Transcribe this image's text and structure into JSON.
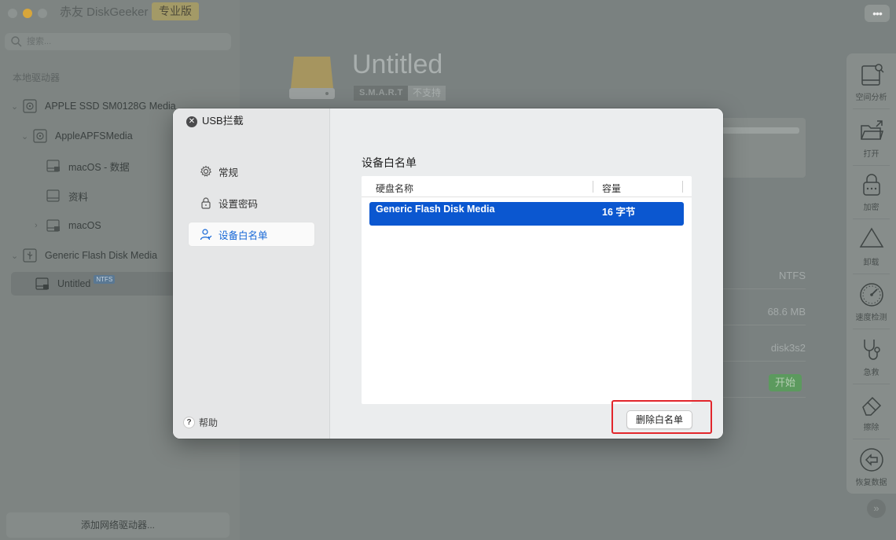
{
  "window": {
    "app_title": "赤友 DiskGeeker",
    "edition_badge": "专业版",
    "more_label": "•••"
  },
  "sidebar": {
    "search_placeholder": "搜索...",
    "section_label": "本地驱动器",
    "tree": [
      {
        "label": "APPLE SSD SM0128G Media",
        "level": 0,
        "expanded": true
      },
      {
        "label": "AppleAPFSMedia",
        "level": 1,
        "expanded": true
      },
      {
        "label": "macOS - 数据",
        "level": 2
      },
      {
        "label": "资料",
        "level": 2
      },
      {
        "label": "macOS",
        "level": 2,
        "collapsed": true
      },
      {
        "label": "Generic Flash Disk Media",
        "level": 0,
        "expanded": true
      },
      {
        "label": "Untitled",
        "level": 1,
        "badge": "NTFS",
        "selected": true
      }
    ],
    "add_network_label": "添加网络驱动器..."
  },
  "main": {
    "disk_title": "Untitled",
    "smart_label": "S.M.A.R.T",
    "smart_status": "不支持",
    "info_values": [
      "NTFS",
      "68.6 MB",
      "disk3s2"
    ],
    "start_label": "开始"
  },
  "toolbar": {
    "items": [
      {
        "label": "空间分析",
        "icon": "space-analysis-icon"
      },
      {
        "label": "打开",
        "icon": "folder-open-icon"
      },
      {
        "label": "加密",
        "icon": "lock-icon"
      },
      {
        "label": "卸载",
        "icon": "eject-icon"
      },
      {
        "label": "速度检测",
        "icon": "speedometer-icon"
      },
      {
        "label": "急救",
        "icon": "stethoscope-icon"
      },
      {
        "label": "擦除",
        "icon": "eraser-icon"
      },
      {
        "label": "恢复数据",
        "icon": "restore-icon"
      }
    ],
    "collapse_label": "»"
  },
  "dialog": {
    "title": "USB拦截",
    "close_label": "✕",
    "nav": [
      {
        "label": "常规",
        "icon": "gear-icon",
        "active": false
      },
      {
        "label": "设置密码",
        "icon": "lock-icon",
        "active": false
      },
      {
        "label": "设备白名单",
        "icon": "user-icon",
        "active": true
      }
    ],
    "help_label": "帮助",
    "help_icon_label": "?",
    "whitelist": {
      "heading": "设备白名单",
      "columns": [
        "硬盘名称",
        "容量"
      ],
      "rows": [
        {
          "name": "Generic Flash Disk Media",
          "capacity": "16 字节",
          "selected": true
        }
      ]
    },
    "remove_button_label": "删除白名单"
  },
  "colors": {
    "accent": "#0b57d0",
    "active_nav_text": "#1466d6",
    "highlight": "#e2262c"
  }
}
